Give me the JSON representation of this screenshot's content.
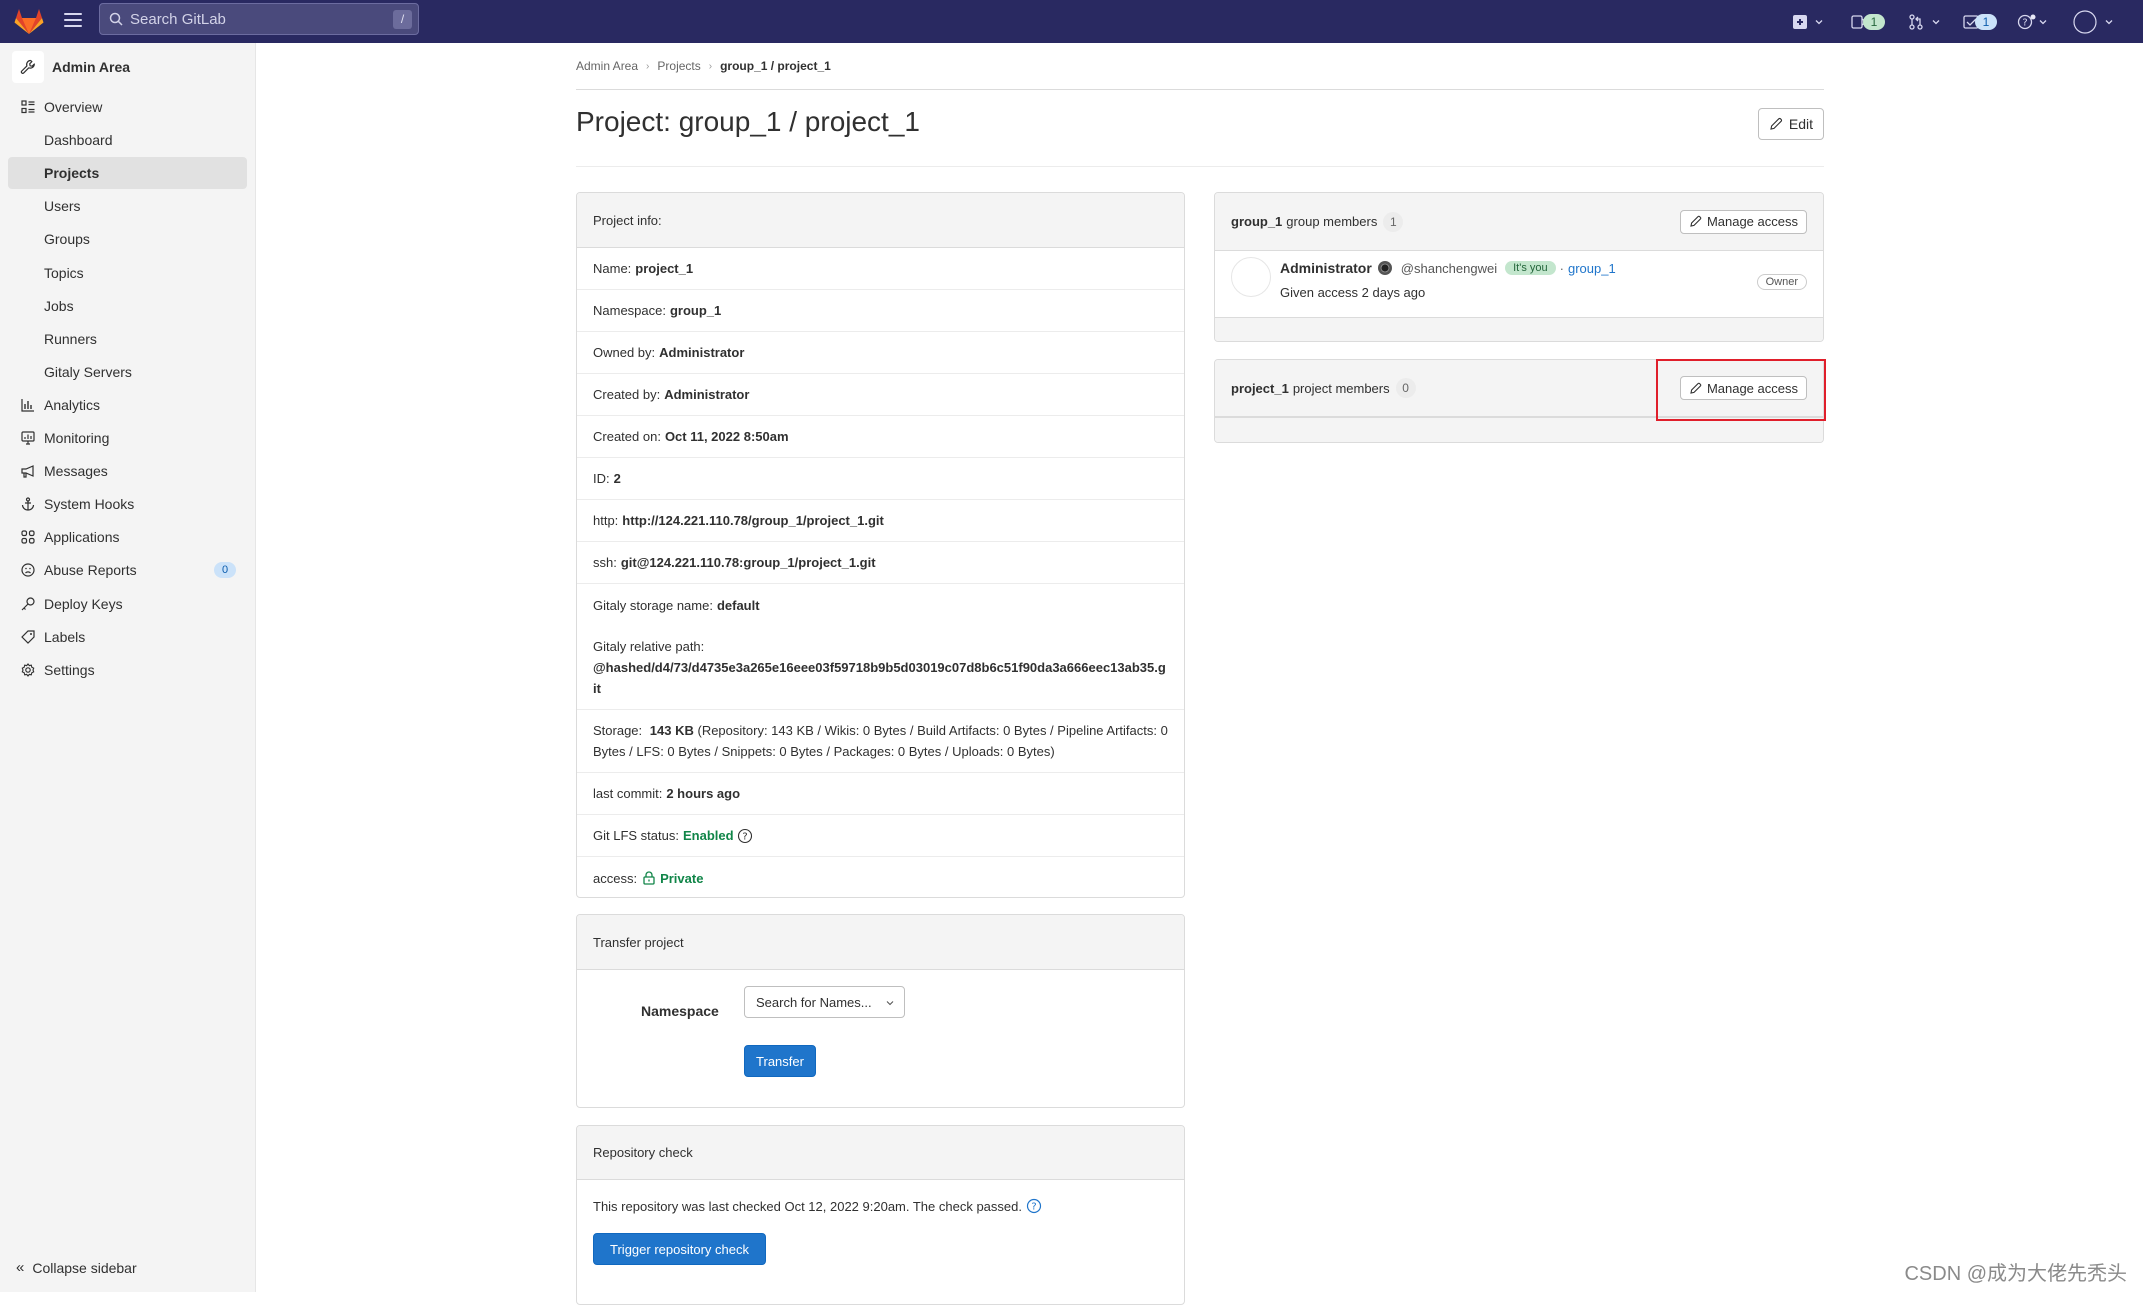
{
  "topbar": {
    "search_placeholder": "Search GitLab",
    "search_shortcut": "/",
    "issues_count": "1",
    "todos_count": "1",
    "colors": {
      "bg": "#292961",
      "issues_badge": "#c3e6cd",
      "todos_badge": "#cbe2f9"
    }
  },
  "sidebar": {
    "title": "Admin Area",
    "items": [
      {
        "label": "Overview",
        "icon": "overview-icon",
        "type": "section"
      },
      {
        "label": "Dashboard",
        "type": "sub"
      },
      {
        "label": "Projects",
        "type": "sub",
        "active": true
      },
      {
        "label": "Users",
        "type": "sub"
      },
      {
        "label": "Groups",
        "type": "sub"
      },
      {
        "label": "Topics",
        "type": "sub"
      },
      {
        "label": "Jobs",
        "type": "sub"
      },
      {
        "label": "Runners",
        "type": "sub"
      },
      {
        "label": "Gitaly Servers",
        "type": "sub"
      },
      {
        "label": "Analytics",
        "icon": "analytics-icon",
        "type": "section"
      },
      {
        "label": "Monitoring",
        "icon": "monitor-icon",
        "type": "section"
      },
      {
        "label": "Messages",
        "icon": "megaphone-icon",
        "type": "section"
      },
      {
        "label": "System Hooks",
        "icon": "anchor-icon",
        "type": "section"
      },
      {
        "label": "Applications",
        "icon": "applications-icon",
        "type": "section"
      },
      {
        "label": "Abuse Reports",
        "icon": "sad-face-icon",
        "type": "section",
        "badge": "0"
      },
      {
        "label": "Deploy Keys",
        "icon": "key-icon",
        "type": "section"
      },
      {
        "label": "Labels",
        "icon": "label-icon",
        "type": "section"
      },
      {
        "label": "Settings",
        "icon": "settings-icon",
        "type": "section"
      }
    ],
    "collapse_label": "Collapse sidebar"
  },
  "breadcrumb": [
    "Admin Area",
    "Projects",
    "group_1 / project_1"
  ],
  "page": {
    "title": "Project: group_1 / project_1",
    "edit_label": "Edit"
  },
  "project_info": {
    "header": "Project info:",
    "rows": [
      {
        "label": "Name:",
        "value": "project_1"
      },
      {
        "label": "Namespace:",
        "value": "group_1"
      },
      {
        "label": "Owned by:",
        "value": "Administrator"
      },
      {
        "label": "Created by:",
        "value": "Administrator"
      },
      {
        "label": "Created on:",
        "value": "Oct 11, 2022 8:50am"
      },
      {
        "label": "ID:",
        "value": "2"
      },
      {
        "label": "http:",
        "value": "http://124.221.110.78/group_1/project_1.git"
      },
      {
        "label": "ssh:",
        "value": "git@124.221.110.78:group_1/project_1.git"
      },
      {
        "label": "Gitaly storage name:",
        "value": "default"
      }
    ],
    "gitaly_path_label": "Gitaly relative path:",
    "gitaly_path_value": "@hashed/d4/73/d4735e3a265e16eee03f59718b9b5d03019c07d8b6c51f90da3a666eec13ab35.git",
    "storage_label": "Storage:",
    "storage_total": "143 KB",
    "storage_detail": "(Repository: 143 KB / Wikis: 0 Bytes / Build Artifacts: 0 Bytes / Pipeline Artifacts: 0 Bytes / LFS: 0 Bytes / Snippets: 0 Bytes / Packages: 0 Bytes / Uploads: 0 Bytes)",
    "last_commit_label": "last commit:",
    "last_commit_value": "2 hours ago",
    "lfs_label": "Git LFS status:",
    "lfs_value": "Enabled",
    "access_label": "access:",
    "access_value": "Private"
  },
  "transfer": {
    "header": "Transfer project",
    "namespace_label": "Namespace",
    "namespace_placeholder": "Search for Names...",
    "transfer_button": "Transfer"
  },
  "repo_check": {
    "header": "Repository check",
    "text": "This repository was last checked Oct 12, 2022 9:20am. The check passed.",
    "button": "Trigger repository check"
  },
  "group_members": {
    "name": "group_1",
    "suffix": "group members",
    "count": "1",
    "manage_label": "Manage access",
    "members": [
      {
        "name": "Administrator",
        "username": "@shanchengwei",
        "badge": "It's you",
        "source_sep": "·",
        "source": "group_1",
        "access_note": "Given access 2 days ago",
        "role": "Owner"
      }
    ]
  },
  "project_members": {
    "name": "project_1",
    "suffix": "project members",
    "count": "0",
    "manage_label": "Manage access"
  },
  "watermark": "CSDN @成为大佬先秃头"
}
